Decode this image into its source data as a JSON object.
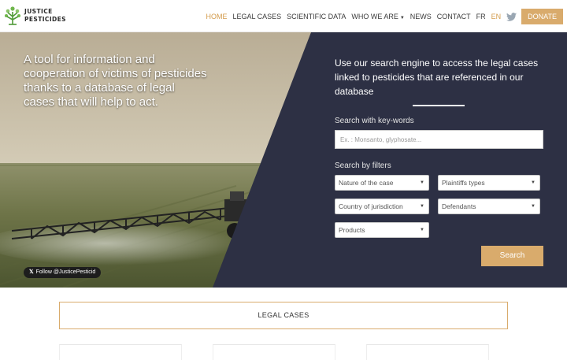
{
  "header": {
    "logo_line1": "JUSTICE",
    "logo_line2": "PESTICIDES",
    "nav": {
      "home": "HOME",
      "legal_cases": "LEGAL CASES",
      "scientific_data": "SCIENTIFIC DATA",
      "who_we_are": "WHO WE ARE",
      "news": "NEWS",
      "contact": "CONTACT",
      "lang_fr": "FR",
      "lang_en": "EN",
      "donate": "DONATE"
    },
    "icons": {
      "twitter": "twitter-icon",
      "dropdown": "caret-down-icon"
    }
  },
  "hero": {
    "tagline": "A tool for information and cooperation of victims of pesticides thanks to a database of legal cases that will help to act.",
    "twitter_follow": "Follow @JusticePesticid"
  },
  "search": {
    "intro": "Use our search engine to access the legal cases linked to pesticides that are referenced in our database",
    "keywords_label": "Search with key-words",
    "keywords_placeholder": "Ex. : Monsanto, glyphosate...",
    "filters_label": "Search by filters",
    "filters": {
      "nature": "Nature of the case",
      "plaintiffs": "Plaintiffs types",
      "country": "Country of jurisdiction",
      "defendants": "Defendants",
      "products": "Products"
    },
    "button": "Search"
  },
  "content": {
    "legal_cases_title": "LEGAL CASES"
  },
  "colors": {
    "accent": "#d9ab6c",
    "active_nav": "#d39b4b",
    "panel_navy": "#2d3044"
  }
}
